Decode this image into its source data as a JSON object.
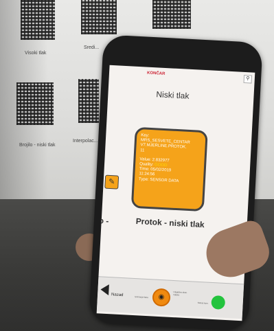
{
  "background": {
    "qr_labels": [
      "Visoki tlak",
      "Sredi...",
      "Brojilo - niski tlak",
      "Interpolac..."
    ]
  },
  "app": {
    "logo": "KONČAR",
    "title": "Niski tlak",
    "corner_icon": "pin-icon",
    "card": {
      "line1": "Key:",
      "line2": "MRS_SESVETE_CENTAR",
      "line3": "V7.MJERLINE.PROTOK.",
      "line4": "11",
      "value": "Value: 2.832977",
      "quality_label": "Quality:",
      "quality_value": "GOOD",
      "time_label": "Time: 05/02/2019",
      "time_value": "11:24:56",
      "type": "Type: SENSOR DATA"
    },
    "edit_icon": "edit-icon",
    "main_label": "Protok - niski tlak",
    "side_label": "o -",
    "bottom": {
      "back_label": "Nazad",
      "small_text_1": "Snimanje tlaka",
      "small_text_2": "Uspješno sken. mjesta",
      "small_text_3": "Status kam.",
      "camera_icon": "camera-icon",
      "status_color": "#23c33d"
    }
  }
}
